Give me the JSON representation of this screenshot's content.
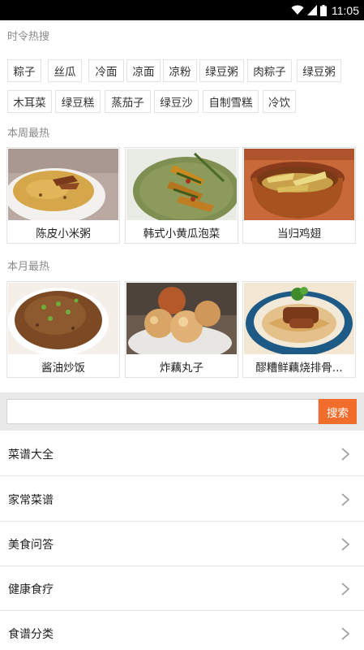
{
  "status_bar": {
    "time": "11:05"
  },
  "seasonal": {
    "title": "时令热搜",
    "tags": [
      "粽子",
      "丝瓜",
      "冷面",
      "凉面",
      "凉粉",
      "绿豆粥",
      "肉粽子",
      "绿豆粥",
      "木耳菜",
      "绿豆糕",
      "蒸茄子",
      "绿豆沙",
      "自制雪糕",
      "冷饮"
    ]
  },
  "weekly": {
    "title": "本周最热",
    "items": [
      {
        "name": "陈皮小米粥"
      },
      {
        "name": "韩式小黄瓜泡菜"
      },
      {
        "name": "当归鸡翅"
      }
    ]
  },
  "monthly": {
    "title": "本月最热",
    "items": [
      {
        "name": "酱油炒饭"
      },
      {
        "name": "炸藕丸子"
      },
      {
        "name": "醪糟鲜藕烧排骨..."
      }
    ]
  },
  "search": {
    "placeholder": "",
    "button_label": "搜索"
  },
  "menu": {
    "items": [
      {
        "label": "菜谱大全"
      },
      {
        "label": "家常菜谱"
      },
      {
        "label": "美食问答"
      },
      {
        "label": "健康食疗"
      },
      {
        "label": "食谱分类"
      }
    ]
  },
  "colors": {
    "accent": "#f26c2b",
    "status_bar": "#000000",
    "section_title": "#8a8a8a"
  }
}
